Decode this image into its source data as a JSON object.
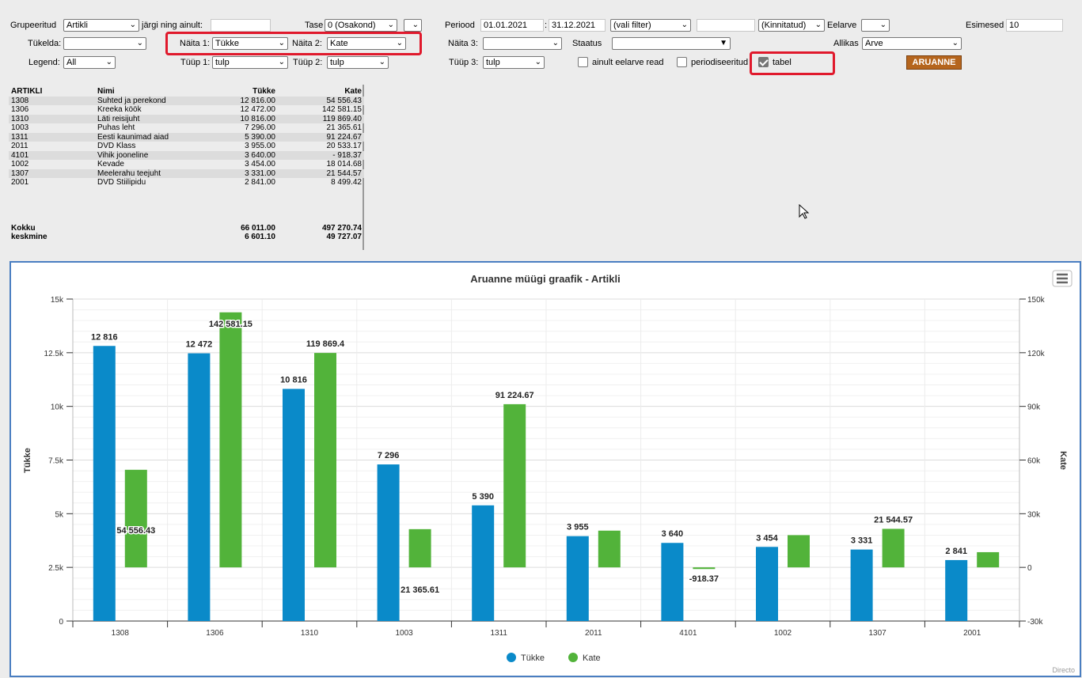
{
  "filters": {
    "row1": {
      "grupeeritud_label": "Grupeeritud",
      "grupeeritud_value": "Artikli",
      "jargi_label": "järgi ning ainult:",
      "jargi_value": "",
      "tase_label": "Tase",
      "tase_value": "0 (Osakond)",
      "periood_label": "Periood",
      "periood_from": "01.01.2021",
      "periood_sep": ":",
      "periood_to": "31.12.2021",
      "vali_filter": "(vali filter)",
      "empty_field": "",
      "kinnitatud": "(Kinnitatud)",
      "eelarve_label": "Eelarve",
      "eelarve_value": "",
      "esimesed_label": "Esimesed",
      "esimesed_value": "10"
    },
    "row2": {
      "tukelda_label": "Tükelda:",
      "tukelda_value": "",
      "naita1_label": "Näita 1:",
      "naita1_value": "Tükke",
      "naita2_label": "Näita 2:",
      "naita2_value": "Kate",
      "naita3_label": "Näita 3:",
      "naita3_value": "",
      "staatus_label": "Staatus",
      "staatus_value": "",
      "allikas_label": "Allikas",
      "allikas_value": "Arve"
    },
    "row3": {
      "legend_label": "Legend:",
      "legend_value": "All",
      "tuup1_label": "Tüüp 1:",
      "tuup1_value": "tulp",
      "tuup2_label": "Tüüp 2:",
      "tuup2_value": "tulp",
      "tuup3_label": "Tüüp 3:",
      "tuup3_value": "tulp",
      "eelarve_read_label": "ainult eelarve read",
      "eelarve_read_checked": false,
      "periodiseeritud_label": "periodiseeritud",
      "periodiseeritud_checked": false,
      "tabel_label": "tabel",
      "tabel_checked": true,
      "report_button": "ARUANNE"
    }
  },
  "table": {
    "headers": [
      "ARTIKLI",
      "Nimi",
      "Tükke",
      "Kate"
    ],
    "rows": [
      [
        "1308",
        "Suhted ja perekond",
        "12 816.00",
        "54 556.43"
      ],
      [
        "1306",
        "Kreeka köök",
        "12 472.00",
        "142 581.15"
      ],
      [
        "1310",
        "Läti reisijuht",
        "10 816.00",
        "119 869.40"
      ],
      [
        "1003",
        "Puhas leht",
        "7 296.00",
        "21 365.61"
      ],
      [
        "1311",
        "Eesti kaunimad aiad",
        "5 390.00",
        "91 224.67"
      ],
      [
        "2011",
        "DVD Klass",
        "3 955.00",
        "20 533.17"
      ],
      [
        "4101",
        "Vihik jooneline",
        "3 640.00",
        "- 918.37"
      ],
      [
        "1002",
        "Kevade",
        "3 454.00",
        "18 014.68"
      ],
      [
        "1307",
        "Meelerahu teejuht",
        "3 331.00",
        "21 544.57"
      ],
      [
        "2001",
        "DVD Stiilipidu",
        "2 841.00",
        "8 499.42"
      ]
    ],
    "total": [
      "Kokku",
      "",
      "66 011.00",
      "497 270.74"
    ],
    "average": [
      "keskmine",
      "",
      "6 601.10",
      "49 727.07"
    ]
  },
  "chart_data": {
    "type": "bar",
    "title": "Aruanne müügi graafik - Artikli",
    "categories": [
      "1308",
      "1306",
      "1310",
      "1003",
      "1311",
      "2011",
      "4101",
      "1002",
      "1307",
      "2001"
    ],
    "series": [
      {
        "name": "Tükke",
        "axis": "left",
        "color": "#0a8ac9",
        "values": [
          12816,
          12472,
          10816,
          7296,
          5390,
          3955,
          3640,
          3454,
          3331,
          2841
        ],
        "labels": [
          "12 816",
          "12 472",
          "10 816",
          "7 296",
          "5 390",
          "3 955",
          "3 640",
          "3 454",
          "3 331",
          "2 841"
        ]
      },
      {
        "name": "Kate",
        "axis": "right",
        "color": "#52b33a",
        "values": [
          54556.43,
          142581.15,
          119869.4,
          21365.61,
          91224.67,
          20533.17,
          -918.37,
          18014.68,
          21544.57,
          8499.42
        ],
        "labels": [
          "54 556.43",
          "142 581.15",
          "119 869.4",
          "21 365.61",
          "91 224.67",
          "",
          "-918.37",
          "",
          "21 544.57",
          ""
        ]
      }
    ],
    "ylabel": "Tükke",
    "ylabel_right": "Kate",
    "ylim": [
      0,
      15000
    ],
    "ylim_right": [
      -30000,
      150000
    ],
    "yticks": [
      "0",
      "2.5k",
      "5k",
      "7.5k",
      "10k",
      "12.5k",
      "15k"
    ],
    "yticks_right": [
      "-30k",
      "0",
      "30k",
      "60k",
      "90k",
      "120k",
      "150k"
    ],
    "grid": true,
    "legend": "bottom-center",
    "credit": "Directo"
  }
}
